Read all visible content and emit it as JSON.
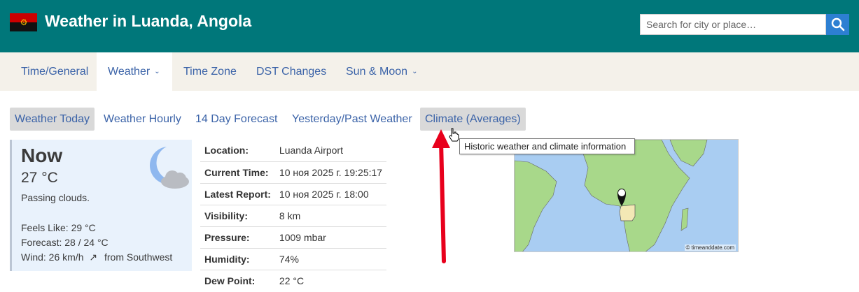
{
  "header": {
    "title": "Weather in Luanda, Angola",
    "flag_icon": "angola-flag",
    "search": {
      "placeholder": "Search for city or place…",
      "button_icon": "search-icon"
    }
  },
  "nav": {
    "items": [
      {
        "label": "Time/General",
        "has_dropdown": false,
        "active": false
      },
      {
        "label": "Weather",
        "has_dropdown": true,
        "active": true
      },
      {
        "label": "Time Zone",
        "has_dropdown": false,
        "active": false
      },
      {
        "label": "DST Changes",
        "has_dropdown": false,
        "active": false
      },
      {
        "label": "Sun & Moon",
        "has_dropdown": true,
        "active": false
      }
    ]
  },
  "subtabs": [
    {
      "label": "Weather Today",
      "active": true
    },
    {
      "label": "Weather Hourly"
    },
    {
      "label": "14 Day Forecast"
    },
    {
      "label": "Yesterday/Past Weather"
    },
    {
      "label": "Climate (Averages)",
      "hovered": true
    }
  ],
  "tooltip": "Historic weather and climate information",
  "now": {
    "title": "Now",
    "temp": "27 °C",
    "desc": "Passing clouds.",
    "feels_like": "Feels Like: 29 °C",
    "forecast": "Forecast: 28 / 24 °C",
    "wind_prefix": "Wind: 26 km/h",
    "wind_arrow": "↗",
    "wind_suffix": "from Southwest",
    "icon": "moon-cloud-icon"
  },
  "info": [
    {
      "key": "Location:",
      "value": "Luanda Airport"
    },
    {
      "key": "Current Time:",
      "value": "10 ноя 2025 г. 19:25:17"
    },
    {
      "key": "Latest Report:",
      "value": "10 ноя 2025 г. 18:00"
    },
    {
      "key": "Visibility:",
      "value": "8 km"
    },
    {
      "key": "Pressure:",
      "value": "1009 mbar"
    },
    {
      "key": "Humidity:",
      "value": "74%"
    },
    {
      "key": "Dew Point:",
      "value": "22 °C"
    }
  ],
  "map": {
    "credit": "© timeanddate.com",
    "marker_icon": "map-pin-icon"
  },
  "colors": {
    "header_bg": "#00777a",
    "link": "#3b63a8",
    "nav_bg": "#f4f1ea",
    "annotation_arrow": "#e8001c"
  }
}
